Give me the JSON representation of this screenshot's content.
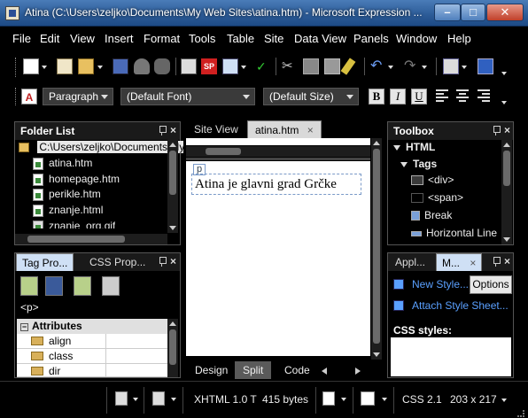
{
  "window": {
    "title": "Atina (C:\\Users\\zeljko\\Documents\\My Web Sites\\atina.htm) - Microsoft Expression ...",
    "minimize": "–",
    "maximize": "□",
    "close": "✕"
  },
  "menu": [
    "File",
    "Edit",
    "View",
    "Insert",
    "Format",
    "Tools",
    "Table",
    "Site",
    "Data View",
    "Panels",
    "Window",
    "Help"
  ],
  "format_toolbar": {
    "style": "Paragraph",
    "font": "(Default Font)",
    "size": "(Default Size)",
    "bold": "B",
    "italic": "I",
    "underline": "U",
    "style_icon_label": "SP"
  },
  "folder_list": {
    "title": "Folder List",
    "path": "C:\\Users\\zeljko\\Documents\\My",
    "files": [
      "atina.htm",
      "homepage.htm",
      "perikle.htm",
      "znanje.html",
      "znanje_org.gif"
    ]
  },
  "tag_props": {
    "tabs": [
      "Tag Pro...",
      "CSS Prop..."
    ],
    "tag": "<p>",
    "section": "Attributes",
    "attributes": [
      "align",
      "class",
      "dir"
    ]
  },
  "editor": {
    "tabs": [
      "Site View",
      "atina.htm"
    ],
    "tab_close": "×",
    "para_tag": "p",
    "content": "Atina je glavni grad Grčke",
    "view_buttons": [
      "Design",
      "Split",
      "Code"
    ],
    "active_view": "Split"
  },
  "toolbox": {
    "title": "Toolbox",
    "group": "HTML",
    "subgroup": "Tags",
    "items": [
      "<div>",
      "<span>",
      "Break",
      "Horizontal Line"
    ]
  },
  "apply_styles": {
    "tabs": [
      "Appl...",
      "M..."
    ],
    "new_style": "New Style...",
    "options": "Options",
    "attach": "Attach Style Sheet...",
    "css_label": "CSS styles:"
  },
  "status": {
    "doctype": "XHTML 1.0 T",
    "size": "415 bytes",
    "css": "CSS 2.1",
    "dimensions": "203 x 217"
  },
  "colors": {
    "titlebar": "#2b5a96",
    "accent_link": "#5aa0ff",
    "panel_bg": "#000000"
  }
}
